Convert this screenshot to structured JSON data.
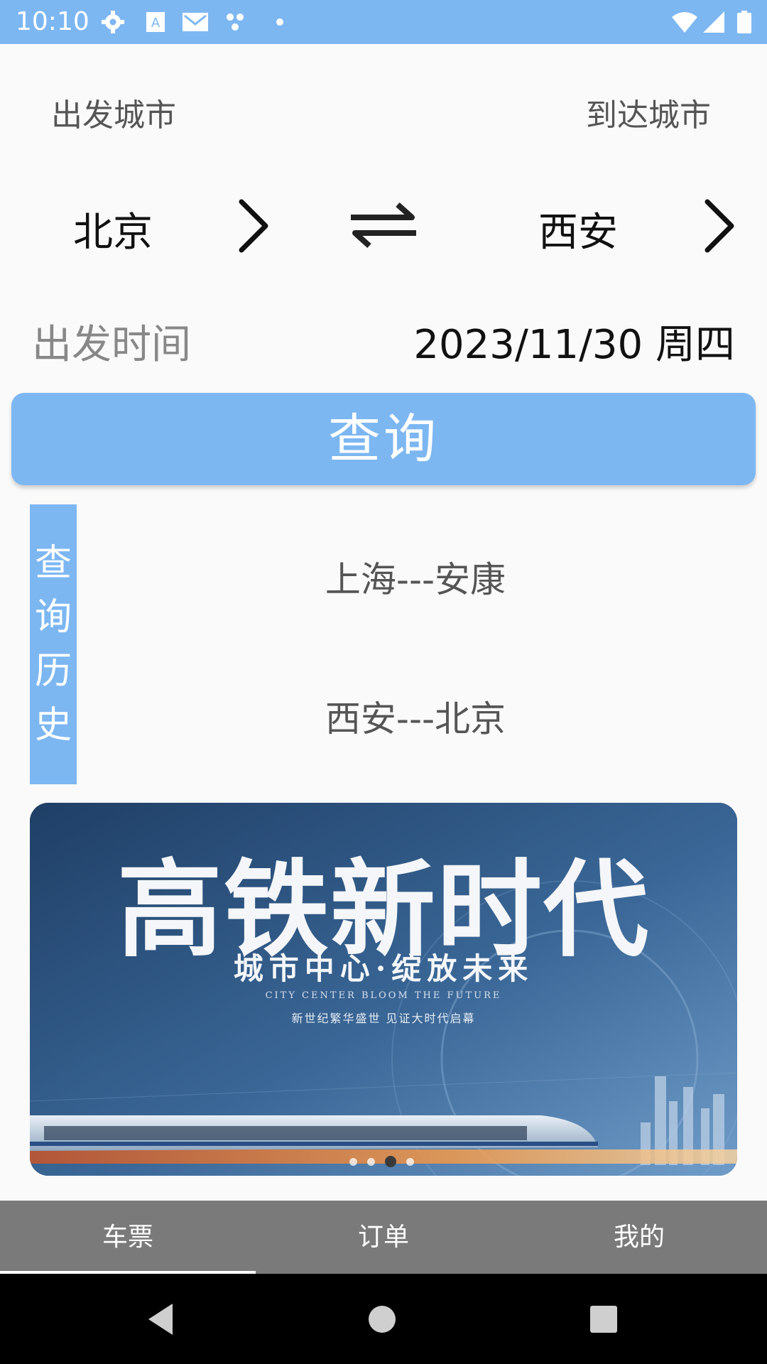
{
  "status_bar": {
    "time": "10:10",
    "icons": [
      "gear-icon",
      "text-a-icon",
      "mail-icon",
      "dots-icon",
      "small-dot-icon",
      "wifi-icon",
      "signal-icon",
      "battery-icon"
    ]
  },
  "route": {
    "from_label": "出发城市",
    "to_label": "到达城市",
    "from_city": "北京",
    "to_city": "西安"
  },
  "departure": {
    "label": "出发时间",
    "date": "2023/11/30 周四"
  },
  "query_button": "查询",
  "history": {
    "title_chars": [
      "查",
      "询",
      "历",
      "史"
    ],
    "items": [
      "上海---安康",
      "西安---北京"
    ]
  },
  "banner": {
    "title": "高铁新时代",
    "subtitle": "城市中心·绽放未来",
    "english": "CITY CENTER   BLOOM THE FUTURE",
    "tagline": "新世纪繁华盛世   见证大时代启幕",
    "pages": 4,
    "active_page": 3
  },
  "bottom_nav": {
    "tabs": [
      "车票",
      "订单",
      "我的"
    ],
    "selected": 0
  },
  "colors": {
    "accent": "#7db7f2",
    "nav_bg": "#7a7a7a",
    "banner_bg": "#24466f"
  }
}
